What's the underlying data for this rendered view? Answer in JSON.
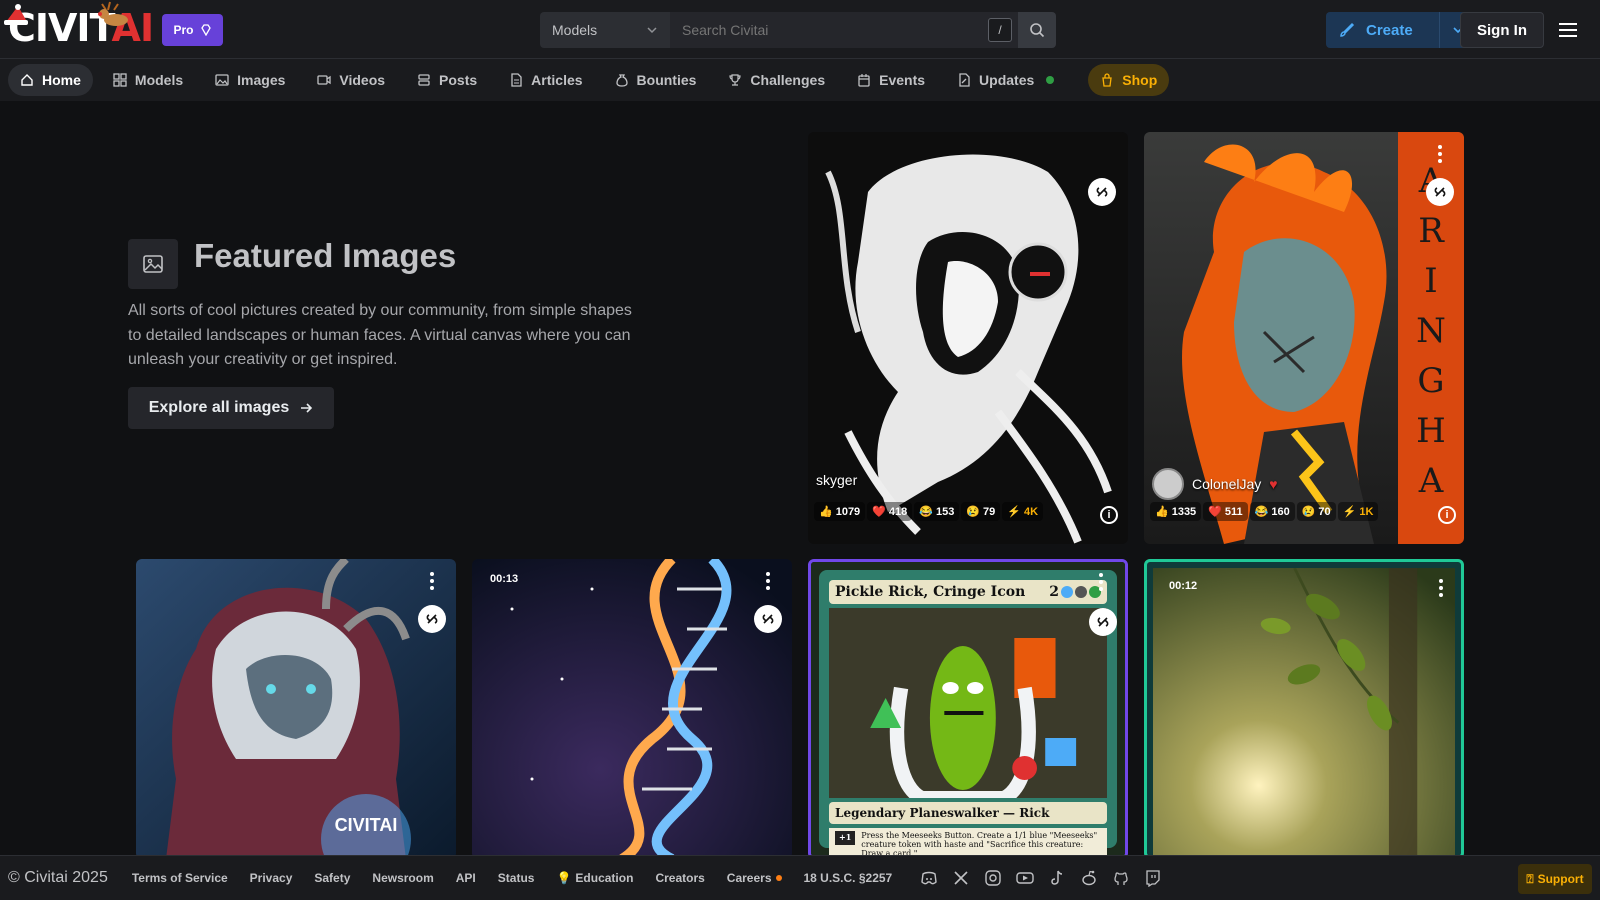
{
  "header": {
    "logo_text_main": "CIVIT",
    "logo_text_accent": "AI",
    "pro_label": "Pro",
    "search": {
      "category": "Models",
      "placeholder": "Search Civitai",
      "shortcut": "/"
    },
    "create_label": "Create",
    "signin_label": "Sign In"
  },
  "nav": {
    "items": [
      {
        "label": "Home",
        "icon": "home-icon",
        "active": true
      },
      {
        "label": "Models",
        "icon": "grid-icon"
      },
      {
        "label": "Images",
        "icon": "image-icon"
      },
      {
        "label": "Videos",
        "icon": "video-icon"
      },
      {
        "label": "Posts",
        "icon": "posts-icon"
      },
      {
        "label": "Articles",
        "icon": "article-icon"
      },
      {
        "label": "Bounties",
        "icon": "moneybag-icon"
      },
      {
        "label": "Challenges",
        "icon": "trophy-icon"
      },
      {
        "label": "Events",
        "icon": "calendar-icon"
      },
      {
        "label": "Updates",
        "icon": "updates-icon"
      },
      {
        "label": "Shop",
        "icon": "shop-icon"
      }
    ]
  },
  "feature": {
    "title": "Featured Images",
    "description": "All sorts of cool pictures created by our community, from simple shapes to detailed landscapes or human faces. A virtual canvas where you can unleash your creativity or get inspired.",
    "button_label": "Explore all images"
  },
  "cards": {
    "skyger": {
      "user": "skyger",
      "likes": "1079",
      "hearts": "418",
      "laughs": "153",
      "cries": "79",
      "buzz": "4K"
    },
    "colonel": {
      "user": "ColonelJay",
      "likes": "1335",
      "hearts": "511",
      "laughs": "160",
      "cries": "70",
      "buzz": "1K"
    },
    "dna": {
      "duration": "00:13"
    },
    "pickle": {
      "card_title": "Pickle Rick, Cringe Icon",
      "card_type": "Legendary Planeswalker — Rick",
      "card_text": "Press the Meeseeks Button. Create a 1/1 blue \"Meeseeks\" creature token with haste and \"Sacrifice this creature: Draw a card.\"",
      "loyalty": "+1",
      "mana": "2"
    },
    "forest": {
      "duration": "00:12"
    }
  },
  "footer": {
    "copyright": "© Civitai 2025",
    "links": [
      "Terms of Service",
      "Privacy",
      "Safety",
      "Newsroom",
      "API",
      "Status",
      "Education",
      "Creators",
      "Careers",
      "18 U.S.C. §2257"
    ],
    "support_label": "Support"
  },
  "colors": {
    "accent": "#4dabf7",
    "pro": "#6741d9",
    "shop": "#fab005",
    "logo_red": "#e03131"
  }
}
